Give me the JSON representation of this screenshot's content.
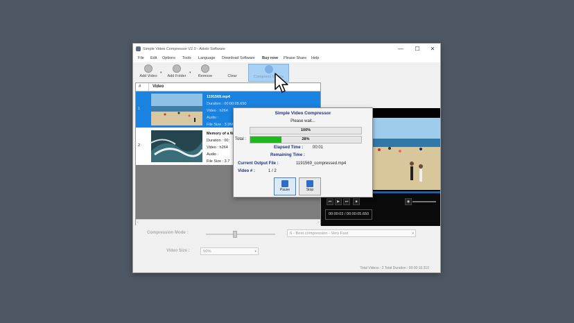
{
  "window": {
    "title": "Simple Video Compressor V2.0 - Adoto Software",
    "controls": {
      "minimize": "—",
      "maximize": "☐",
      "close": "✕"
    }
  },
  "menu": [
    "File",
    "Edit",
    "Options",
    "Tools",
    "Language",
    "Download Software",
    "Buy now",
    "Please Share",
    "Help"
  ],
  "toolbar": {
    "add_video": "Add Video",
    "add_folder": "Add Folder",
    "remove": "Remove",
    "clear": "Clear",
    "compress": "Compress Videos"
  },
  "list": {
    "col_num": "#",
    "col_video": "Video",
    "rows": [
      {
        "num": "1",
        "name": "1191569.mp4",
        "duration": "Duration : 00:00:05.650",
        "video": "Video : h264",
        "audio": "Audio :",
        "size": "File Size : 3.9MB"
      },
      {
        "num": "2",
        "name": "Memory of a W",
        "duration": "Duration : 00:",
        "video": "Video : h264",
        "audio": "Audio :",
        "size": "File Size : 3.7"
      }
    ]
  },
  "preview": {
    "time": "00:00:03 / 00:00:05.650"
  },
  "options": {
    "compression_label": "Compression Mode :",
    "compression_value": "6 - Best compression - Very Fast",
    "size_label": "Video Size :",
    "size_value": "50%"
  },
  "status": "Total Videos : 2   Total Duration : 00:00:10.310",
  "dialog": {
    "title": "Simple Video Compressor",
    "please_wait": "Please wait...",
    "progress_file": {
      "text": "100%",
      "fraction": 1.0
    },
    "total_label": "Total :",
    "progress_total": {
      "text": "28%",
      "fraction": 0.28
    },
    "elapsed_label": "Elapsed Time :",
    "elapsed_value": "00:01",
    "remaining_label": "Remaining Time :",
    "remaining_value": "",
    "output_label": "Current Output File :",
    "output_value": "1191569_compressed.mp4",
    "videonum_label": "Video # :",
    "videonum_value": "1 / 2",
    "pause": "Pause",
    "stop": "Stop"
  },
  "colors": {
    "accent": "#1a83e0",
    "progress": "#1fb81f",
    "dialog_title": "#1f2f80"
  }
}
